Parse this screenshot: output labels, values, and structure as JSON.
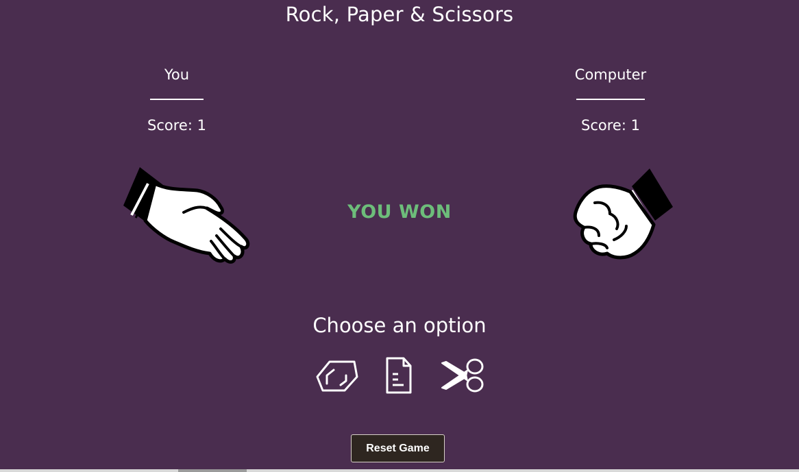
{
  "title": "Rock, Paper & Scissors",
  "players": {
    "you": {
      "name": "You",
      "score_label": "Score: 1",
      "hand": "paper-hand"
    },
    "computer": {
      "name": "Computer",
      "score_label": "Score: 1",
      "hand": "rock-hand"
    }
  },
  "result": {
    "text": "YOU WON",
    "color": "#6dbd7a"
  },
  "choose": {
    "label": "Choose an option",
    "options": [
      "rock-icon",
      "paper-icon",
      "scissors-icon"
    ]
  },
  "reset_label": "Reset Game",
  "colors": {
    "background": "#4a2d4f",
    "text": "#ffffff",
    "button": "#2e2620"
  }
}
